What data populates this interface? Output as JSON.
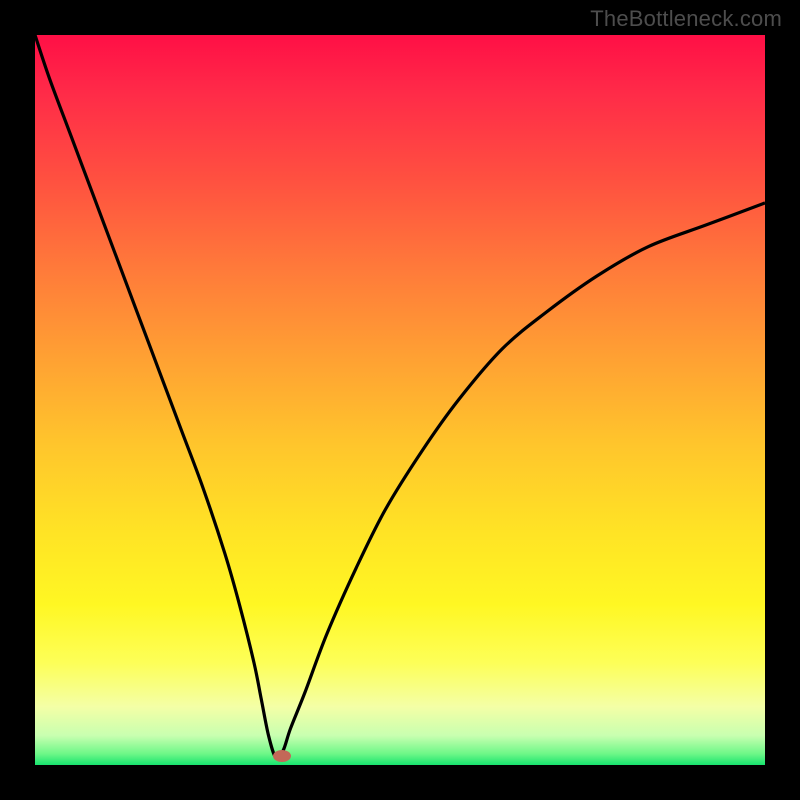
{
  "attribution": "TheBottleneck.com",
  "colors": {
    "frame": "#000000",
    "gradient_top": "#ff0f46",
    "gradient_mid1": "#ff7a3a",
    "gradient_mid2": "#ffe325",
    "gradient_bottom": "#17e36e",
    "curve": "#000000",
    "marker": "#c36858"
  },
  "chart_data": {
    "type": "line",
    "title": "",
    "xlabel": "",
    "ylabel": "",
    "xlim": [
      0,
      100
    ],
    "ylim": [
      0,
      100
    ],
    "notes": "V-shaped bottleneck curve. Minimum (ideal match) lies near x≈33 where the curve touches y≈0. Left branch starts near top-left and descends steeply; right branch rises with diminishing slope toward the upper-right. Background vertical gradient encodes bottleneck severity: red (high/bad) at top → green (low/good) at bottom.",
    "series": [
      {
        "name": "bottleneck-curve",
        "x": [
          0,
          2,
          5,
          8,
          11,
          14,
          17,
          20,
          23,
          26,
          28,
          30,
          31,
          32,
          33,
          34,
          35,
          37,
          40,
          44,
          48,
          53,
          58,
          64,
          70,
          77,
          84,
          92,
          100
        ],
        "y": [
          100,
          94,
          86,
          78,
          70,
          62,
          54,
          46,
          38,
          29,
          22,
          14,
          9,
          4,
          1,
          2,
          5,
          10,
          18,
          27,
          35,
          43,
          50,
          57,
          62,
          67,
          71,
          74,
          77
        ]
      }
    ],
    "marker": {
      "x": 33.8,
      "y": 1.2,
      "label": "optimal-point"
    }
  }
}
